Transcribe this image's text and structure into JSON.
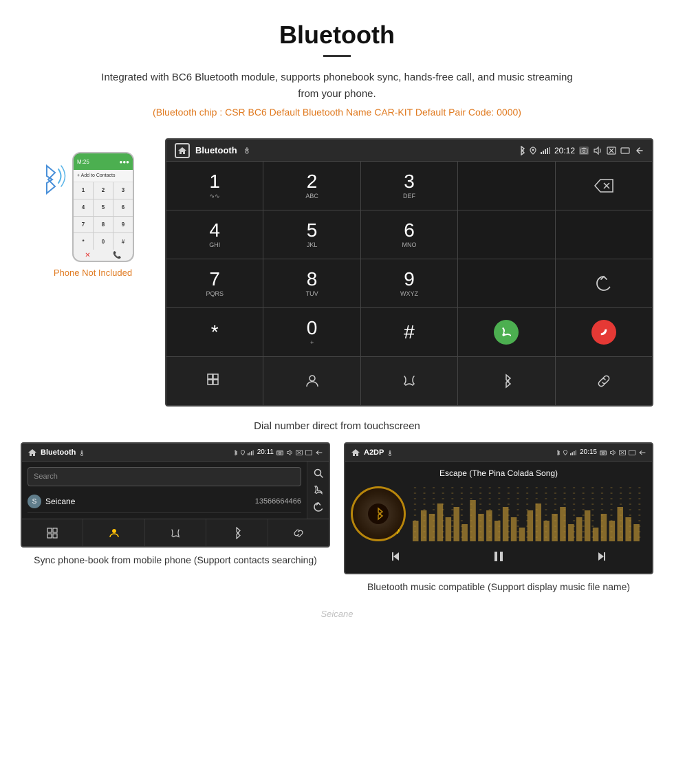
{
  "header": {
    "title": "Bluetooth",
    "description": "Integrated with BC6 Bluetooth module, supports phonebook sync, hands-free call, and music streaming from your phone.",
    "specs": "(Bluetooth chip : CSR BC6    Default Bluetooth Name CAR-KIT    Default Pair Code: 0000)"
  },
  "phone_label": "Phone Not Included",
  "large_screen": {
    "status_bar": {
      "title": "Bluetooth",
      "time": "20:12"
    },
    "dialpad": [
      {
        "number": "1",
        "letters": "∽∽"
      },
      {
        "number": "2",
        "letters": "ABC"
      },
      {
        "number": "3",
        "letters": "DEF"
      },
      {
        "number": "",
        "letters": ""
      },
      {
        "number": "⌫",
        "letters": ""
      },
      {
        "number": "4",
        "letters": "GHI"
      },
      {
        "number": "5",
        "letters": "JKL"
      },
      {
        "number": "6",
        "letters": "MNO"
      },
      {
        "number": "",
        "letters": ""
      },
      {
        "number": "",
        "letters": ""
      },
      {
        "number": "7",
        "letters": "PQRS"
      },
      {
        "number": "8",
        "letters": "TUV"
      },
      {
        "number": "9",
        "letters": "WXYZ"
      },
      {
        "number": "",
        "letters": ""
      },
      {
        "number": "↺",
        "letters": ""
      },
      {
        "number": "*",
        "letters": ""
      },
      {
        "number": "0",
        "letters": "+"
      },
      {
        "number": "#",
        "letters": ""
      },
      {
        "number": "📞",
        "letters": ""
      },
      {
        "number": "📞end",
        "letters": ""
      }
    ],
    "toolbar_buttons": [
      "⊞",
      "👤",
      "📞",
      "✱",
      "🔗"
    ]
  },
  "dial_caption": "Dial number direct from touchscreen",
  "phonebook_screen": {
    "status_bar": {
      "title": "Bluetooth",
      "time": "20:11"
    },
    "search_placeholder": "Search",
    "contacts": [
      {
        "letter": "S",
        "name": "Seicane",
        "number": "13566664466"
      }
    ],
    "toolbar_buttons": [
      "⊞",
      "👤",
      "📞",
      "✱",
      "🔗"
    ]
  },
  "music_screen": {
    "status_bar": {
      "title": "A2DP",
      "time": "20:15"
    },
    "song_title": "Escape (The Pina Colada Song)",
    "controls": [
      "⏮",
      "⏯",
      "⏭"
    ]
  },
  "bottom_captions": {
    "phonebook": "Sync phone-book from mobile phone\n(Support contacts searching)",
    "music": "Bluetooth music compatible\n(Support display music file name)"
  },
  "watermark": "Seicane"
}
